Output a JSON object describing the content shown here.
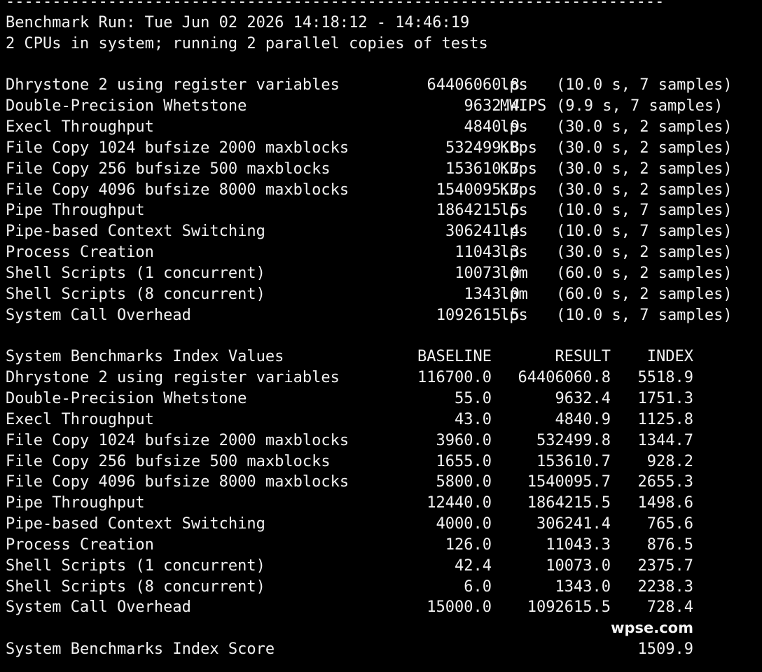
{
  "terminal": {
    "separator": "------------------------------------------------------------------------",
    "run_header": "Benchmark Run: Tue Jun 02 2026 14:18:12 - 14:46:19",
    "cpu_info": "2 CPUs in system; running 2 parallel copies of tests"
  },
  "results": [
    {
      "name": "Dhrystone 2 using register variables",
      "value": "64406060.8",
      "unit": "lps",
      "samples": "(10.0 s, 7 samples)"
    },
    {
      "name": "Double-Precision Whetstone",
      "value": "9632.4",
      "unit": "MWIPS",
      "samples": "(9.9 s, 7 samples)"
    },
    {
      "name": "Execl Throughput",
      "value": "4840.9",
      "unit": "lps",
      "samples": "(30.0 s, 2 samples)"
    },
    {
      "name": "File Copy 1024 bufsize 2000 maxblocks",
      "value": "532499.8",
      "unit": "KBps",
      "samples": "(30.0 s, 2 samples)"
    },
    {
      "name": "File Copy 256 bufsize 500 maxblocks",
      "value": "153610.7",
      "unit": "KBps",
      "samples": "(30.0 s, 2 samples)"
    },
    {
      "name": "File Copy 4096 bufsize 8000 maxblocks",
      "value": "1540095.7",
      "unit": "KBps",
      "samples": "(30.0 s, 2 samples)"
    },
    {
      "name": "Pipe Throughput",
      "value": "1864215.5",
      "unit": "lps",
      "samples": "(10.0 s, 7 samples)"
    },
    {
      "name": "Pipe-based Context Switching",
      "value": "306241.4",
      "unit": "lps",
      "samples": "(10.0 s, 7 samples)"
    },
    {
      "name": "Process Creation",
      "value": "11043.3",
      "unit": "lps",
      "samples": "(30.0 s, 2 samples)"
    },
    {
      "name": "Shell Scripts (1 concurrent)",
      "value": "10073.0",
      "unit": "lpm",
      "samples": "(60.0 s, 2 samples)"
    },
    {
      "name": "Shell Scripts (8 concurrent)",
      "value": "1343.0",
      "unit": "lpm",
      "samples": "(60.0 s, 2 samples)"
    },
    {
      "name": "System Call Overhead",
      "value": "1092615.5",
      "unit": "lps",
      "samples": "(10.0 s, 7 samples)"
    }
  ],
  "index_table": {
    "title": "System Benchmarks Index Values",
    "col_baseline": "BASELINE",
    "col_result": "RESULT",
    "col_index": "INDEX",
    "rows": [
      {
        "name": "Dhrystone 2 using register variables",
        "baseline": "116700.0",
        "result": "64406060.8",
        "index": "5518.9"
      },
      {
        "name": "Double-Precision Whetstone",
        "baseline": "55.0",
        "result": "9632.4",
        "index": "1751.3"
      },
      {
        "name": "Execl Throughput",
        "baseline": "43.0",
        "result": "4840.9",
        "index": "1125.8"
      },
      {
        "name": "File Copy 1024 bufsize 2000 maxblocks",
        "baseline": "3960.0",
        "result": "532499.8",
        "index": "1344.7"
      },
      {
        "name": "File Copy 256 bufsize 500 maxblocks",
        "baseline": "1655.0",
        "result": "153610.7",
        "index": "928.2"
      },
      {
        "name": "File Copy 4096 bufsize 8000 maxblocks",
        "baseline": "5800.0",
        "result": "1540095.7",
        "index": "2655.3"
      },
      {
        "name": "Pipe Throughput",
        "baseline": "12440.0",
        "result": "1864215.5",
        "index": "1498.6"
      },
      {
        "name": "Pipe-based Context Switching",
        "baseline": "4000.0",
        "result": "306241.4",
        "index": "765.6"
      },
      {
        "name": "Process Creation",
        "baseline": "126.0",
        "result": "11043.3",
        "index": "876.5"
      },
      {
        "name": "Shell Scripts (1 concurrent)",
        "baseline": "42.4",
        "result": "10073.0",
        "index": "2375.7"
      },
      {
        "name": "Shell Scripts (8 concurrent)",
        "baseline": "6.0",
        "result": "1343.0",
        "index": "2238.3"
      },
      {
        "name": "System Call Overhead",
        "baseline": "15000.0",
        "result": "1092615.5",
        "index": "728.4"
      }
    ],
    "score_label": "System Benchmarks Index Score",
    "score_value": "1509.9"
  },
  "watermark": "wpse.com",
  "colors": {
    "background": "#000000",
    "text": "#f2f2f2"
  }
}
